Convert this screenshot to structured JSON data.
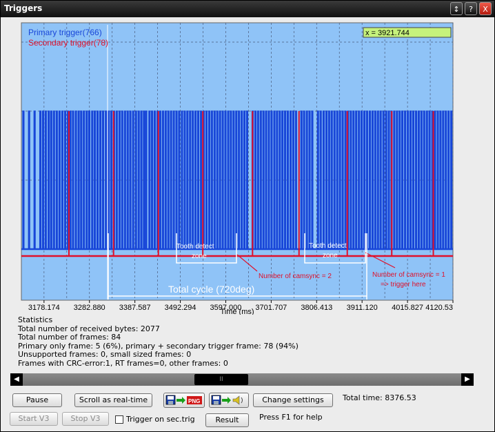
{
  "window": {
    "title": "Triggers",
    "buttons": {
      "resize": "↕",
      "help": "?",
      "close": "X"
    }
  },
  "chart_data": {
    "type": "line",
    "legend": [
      {
        "name": "Primary trigger(766)",
        "color": "#1846d8"
      },
      {
        "name": "Secondary trigger(78)",
        "color": "#e0102a"
      }
    ],
    "cursor_readout": "x = 3921.744",
    "xlabel": "Time (ms)",
    "x_ticks": [
      "3178.174",
      "3282.880",
      "3387.587",
      "3492.294",
      "3597.000",
      "3701.707",
      "3806.413",
      "3911.120",
      "4015.827",
      "4120.53"
    ],
    "xlim": [
      3126.0,
      4120.53
    ],
    "grid": true,
    "background_color": "#8fc3f7",
    "primary_pulse_times": [
      3129.5,
      3142.6,
      3155.3,
      3168.5,
      3174.8,
      3181.0,
      3187.8,
      3193.6,
      3199.9,
      3206.4,
      3212.7,
      3219.2,
      3225.7,
      3232.1,
      3237.8,
      3243.9,
      3250.4,
      3256.8,
      3262.7,
      3268.9,
      3275.4,
      3281.3,
      3288.1,
      3294.1,
      3300.4,
      3306.7,
      3313.0,
      3319.7,
      3326.1,
      3332.2,
      3338.4,
      3344.6,
      3351.0,
      3357.2,
      3363.6,
      3369.8,
      3375.9,
      3382.4,
      3388.8,
      3395.2,
      3401.3,
      3407.4,
      3412.4,
      3420.0,
      3426.0,
      3432.2,
      3438.6,
      3444.7,
      3451.1,
      3457.3,
      3463.5,
      3469.7,
      3476.0,
      3482.3,
      3488.5,
      3494.9,
      3501.2,
      3507.4,
      3513.7,
      3519.9,
      3526.2,
      3532.4,
      3538.8,
      3545.0,
      3551.3,
      3557.7,
      3563.8,
      3570.1,
      3576.3,
      3582.5,
      3588.8,
      3595.1,
      3601.5,
      3607.6,
      3613.9,
      3620.1,
      3626.3,
      3632.7,
      3638.9,
      3645.1,
      3657.7,
      3664.0,
      3670.2,
      3676.5,
      3682.7,
      3688.8,
      3695.1,
      3701.4,
      3707.9,
      3714.0,
      3720.3,
      3726.4,
      3732.6,
      3738.8,
      3745.2,
      3751.4,
      3757.7,
      3770.2,
      3776.3,
      3782.7,
      3788.9,
      3795.2,
      3808.3,
      3814.6,
      3821.3,
      3827.7,
      3833.9,
      3840.0,
      3846.4,
      3852.7,
      3858.9,
      3865.2,
      3871.6,
      3877.7,
      3884.0,
      3890.2,
      3896.4,
      3902.8,
      3909.0,
      3915.2,
      3921.4,
      3927.8,
      3934.0,
      3940.3,
      3946.5,
      3952.7,
      3959.2,
      3965.4,
      3971.6,
      3977.8,
      3984.1,
      3990.4,
      3996.6,
      4002.7,
      4009.1,
      4015.5,
      4021.7,
      4027.9,
      4034.3,
      4040.5,
      4046.7,
      4053.0,
      4059.3,
      4065.5,
      4071.8,
      4078.0,
      4084.4,
      4090.6,
      4096.8,
      4103.0,
      4109.3,
      4115.6
    ],
    "secondary_pulse_times": [
      3235.6,
      3338.4,
      3441.7,
      3544.1,
      3658.7,
      3765.8,
      3877.0,
      3979.5,
      4075.3
    ]
  },
  "annotations": {
    "tooth_zone_1": [
      "Tooth detect",
      "zone"
    ],
    "tooth_zone_2": [
      "Tooth detect",
      "zone"
    ],
    "camsync_2": "Number of camsync = 2",
    "camsync_1": [
      "Number of camsync = 1",
      "=> trigger here"
    ],
    "total_cycle": "Total cycle (720deg)"
  },
  "stats": {
    "heading": "Statistics",
    "lines": [
      "Total number of received bytes: 2077",
      "Total number of frames: 84",
      "Primary only frame: 5 (6%), primary + secondary trigger frame: 78 (94%)",
      "Unsupported frames: 0, small sized frames: 0",
      "Frames with CRC-error:1, RT frames=0, other frames: 0"
    ]
  },
  "scrollbar": {
    "left": "◀",
    "right": "▶",
    "thumb": "II"
  },
  "controls": {
    "pause": "Pause",
    "scroll_realtime": "Scroll as real-time",
    "save_png_icon": "save-to-png-icon",
    "save_sound_icon": "save-to-sound-icon",
    "change_settings": "Change settings",
    "total_time": "Total time: 8376.53",
    "start_v3": "Start V3",
    "stop_v3": "Stop V3",
    "trigger_on_sec": "Trigger on sec.trig",
    "result": "Result",
    "help": "Press F1 for help"
  }
}
